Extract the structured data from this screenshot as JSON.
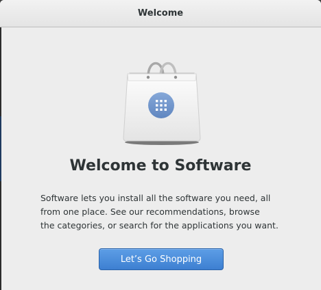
{
  "window": {
    "title": "Welcome"
  },
  "welcome": {
    "heading": "Welcome to Software",
    "description_lines": [
      "Software lets you install all the software you need, all",
      "from one place. See our recommendations, browse",
      "the categories, or search for the applications you want."
    ],
    "button_label": "Let’s Go Shopping"
  },
  "icons": {
    "bag": "shopping-bag-icon",
    "grid": "app-grid-icon"
  },
  "colors": {
    "accent": "#4a8bd8",
    "badge": "#6d93c6"
  }
}
